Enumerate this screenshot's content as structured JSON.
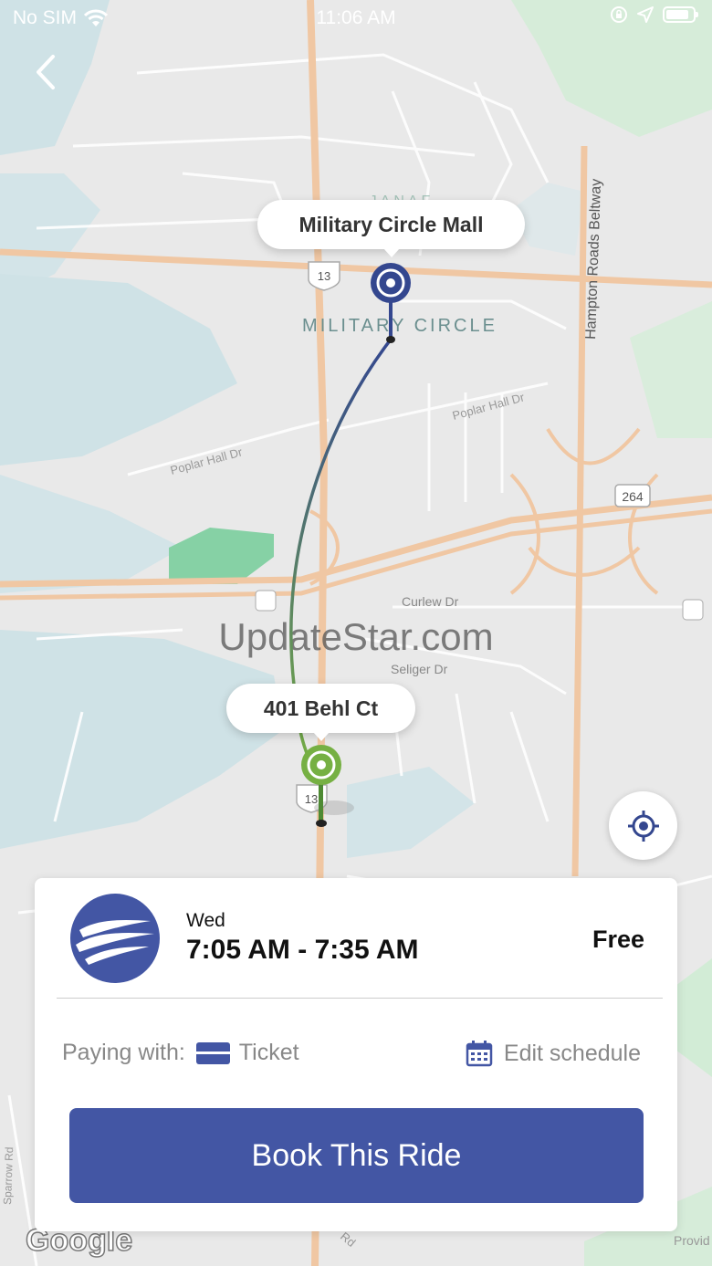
{
  "status_bar": {
    "carrier": "No SIM",
    "time": "11:06 AM"
  },
  "map": {
    "labels": {
      "janaf": "JANAF",
      "military_circle_area": "MILITARY CIRCLE",
      "beltway": "Hampton Roads Beltway",
      "poplar_hall_dr": "Poplar Hall Dr",
      "curlew_dr": "Curlew Dr",
      "seliger_dr": "Seliger Dr",
      "route_13": "13",
      "route_264": "264",
      "watermark": "UpdateStar.com",
      "google": "Google",
      "sparrow_rd": "Sparrow Rd",
      "rd_fragment": "Rd",
      "provid_fragment": "Provid"
    },
    "colors": {
      "origin_pin": "#76b043",
      "destination_pin": "#34478f"
    }
  },
  "pickup_label": "401 Behl Ct",
  "dropoff_label": "Military Circle Mall",
  "ride_card": {
    "day": "Wed",
    "time_range": "7:05 AM - 7:35 AM",
    "price": "Free",
    "paying_with_label": "Paying with:",
    "payment_method": "Ticket",
    "edit_schedule_label": "Edit schedule",
    "book_button_label": "Book This Ride",
    "accent_color": "#4356a4"
  }
}
